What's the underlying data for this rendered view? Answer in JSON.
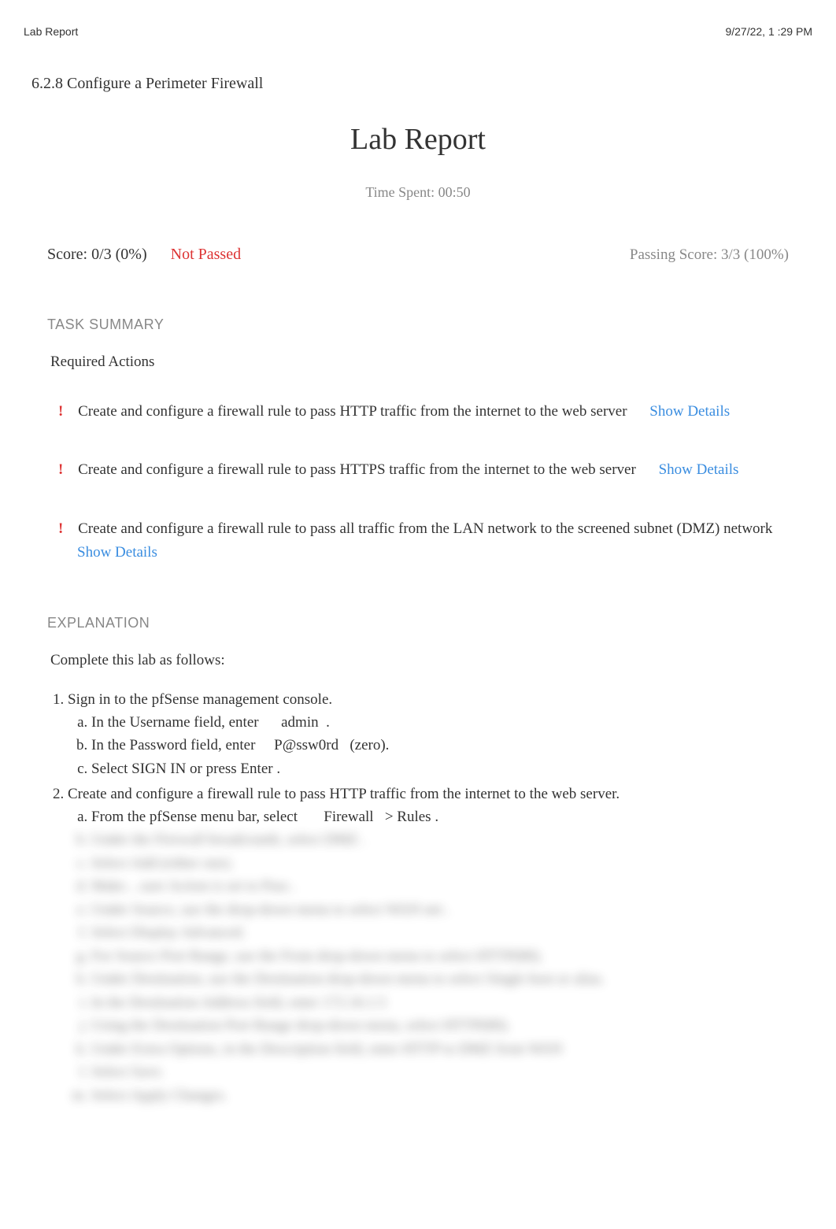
{
  "header": {
    "doc_title": "Lab Report",
    "datetime": "9/27/22, 1 :29 PM"
  },
  "section_title": "6.2.8 Configure a Perimeter Firewall",
  "report": {
    "title": "Lab Report",
    "time_spent": "Time Spent: 00:50",
    "score_text": "Score: 0/3 (0%)",
    "status": "Not Passed",
    "passing": "Passing Score: 3/3 (100%)"
  },
  "task_summary": {
    "heading": "TASK SUMMARY",
    "required": "Required Actions",
    "items": [
      {
        "text": "Create and configure a firewall rule to pass HTTP traffic from the internet to the web server",
        "link": "Show Details"
      },
      {
        "text": "Create and configure a firewall rule to pass HTTPS traffic from the internet to the web server",
        "link": "Show Details"
      },
      {
        "text": "Create and configure a firewall rule to pass all traffic from the LAN network to the screened subnet (DMZ) network",
        "link": "Show Details"
      }
    ]
  },
  "explanation": {
    "heading": "EXPLANATION",
    "intro": "Complete this lab as follows:",
    "step1": "Sign in to the pfSense management console.",
    "step1a_pre": "In the Username field, enter ",
    "step1a_kw": "     admin  .",
    "step1b_pre": "In the Password field, enter ",
    "step1b_kw": "    P@ssw0rd   (zero).",
    "step1c": " Select  SIGN IN or press   Enter .",
    "step2": "Create and configure a firewall rule to pass HTTP traffic from the internet to the web server.",
    "step2a_pre": "From the pfSense menu bar, select ",
    "step2a_kw": "      Firewall   > Rules .",
    "blurred": {
      "b": "Under the  Firewall breadcrumb, select    DMZ .",
      "c": "Select  Add (either one).",
      "d": "Make…sure  Action is set to  Pass .",
      "e": "Under Source, use the drop-down menu to select           WAN net .",
      "f": "Select  Display Advanced.",
      "g": "For Source Port Range, use the    From drop-down menu to select      HTTP(80).",
      "h": "Under Destination, use the   Destination drop-down menu to select     Single host or alias.",
      "i": "In the Destination Address field, enter         172.16.1.5",
      "j": "Using the Destination Port Range drop-down menu, select          HTTP(80).",
      "k": "Under Extra Options, in the Description field, enter         HTTP to DMZ from WAN",
      "l": "Select  Save.",
      "m": "Select  Apply Changes."
    }
  }
}
